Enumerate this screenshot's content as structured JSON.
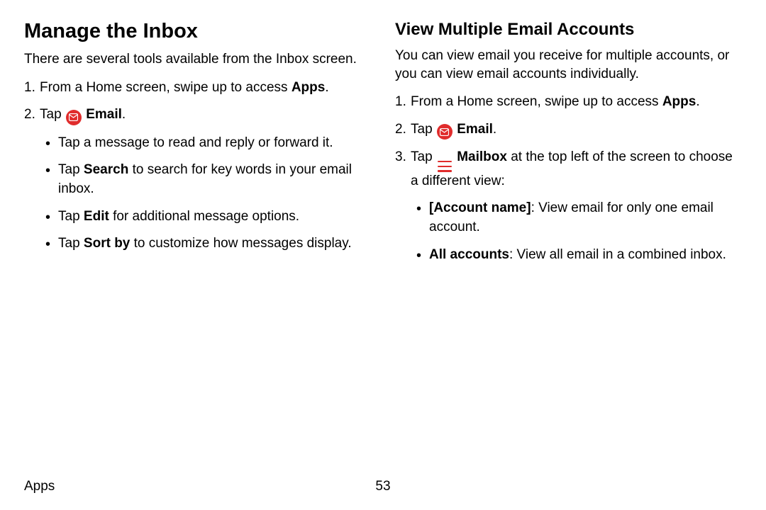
{
  "left": {
    "heading": "Manage the Inbox",
    "intro": "There are several tools available from the Inbox screen.",
    "step1_pre": "From a Home screen, swipe up to access ",
    "step1_bold": "Apps",
    "step1_post": ".",
    "step2_pre": "Tap ",
    "step2_bold": "Email",
    "step2_post": ".",
    "bullet1": "Tap a message to read and reply or forward it.",
    "bullet2_pre": "Tap ",
    "bullet2_bold": "Search",
    "bullet2_post": " to search for key words in your email inbox.",
    "bullet3_pre": "Tap ",
    "bullet3_bold": "Edit",
    "bullet3_post": " for additional message options.",
    "bullet4_pre": "Tap ",
    "bullet4_bold": "Sort by",
    "bullet4_post": " to customize how messages display."
  },
  "right": {
    "heading": "View Multiple Email Accounts",
    "intro": "You can view email you receive for multiple accounts, or you can view email accounts individually.",
    "step1_pre": "From a Home screen, swipe up to access ",
    "step1_bold": "Apps",
    "step1_post": ".",
    "step2_pre": "Tap ",
    "step2_bold": "Email",
    "step2_post": ".",
    "step3_pre": "Tap ",
    "step3_bold": "Mailbox",
    "step3_post": " at the top left of the screen to choose a different view:",
    "bullet1_bold": "[Account name]",
    "bullet1_post": ": View email for only one email account.",
    "bullet2_bold": "All accounts",
    "bullet2_post": ": View all email in a combined inbox."
  },
  "footer": {
    "section": "Apps",
    "page": "53"
  }
}
